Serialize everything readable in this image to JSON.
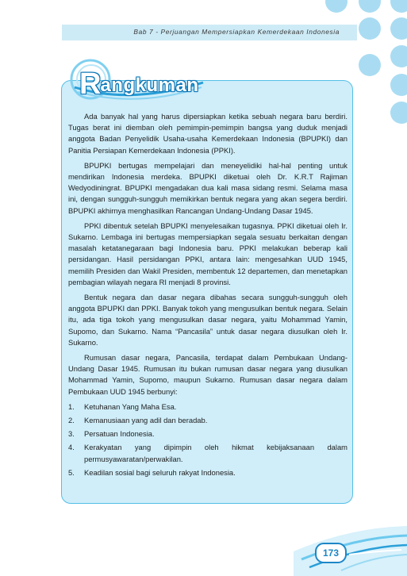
{
  "header": {
    "chapter_title": "Bab 7 - Perjuangan Mempersiapkan Kemerdekaan Indonesia"
  },
  "section": {
    "title_first": "R",
    "title_rest": "angkuman"
  },
  "paragraphs": [
    "Ada banyak hal yang harus dipersiapkan ketika sebuah negara baru berdiri. Tugas berat ini diemban oleh pemimpin-pemimpin bangsa yang duduk menjadi anggota Badan Penyelidik Usaha-usaha Kemerdekaan Indonesia (BPUPKI) dan Panitia Persiapan Kemerdekaan Indonesia (PPKI).",
    "BPUPKI bertugas mempelajari dan meneyelidiki hal-hal penting untuk mendirikan Indonesia merdeka. BPUPKI diketuai oleh Dr. K.R.T Rajiman Wedyodiningrat. BPUPKI mengadakan dua kali masa sidang resmi. Selama masa ini, dengan sungguh-sungguh memikirkan bentuk negara yang akan segera berdiri. BPUPKI akhirnya menghasilkan Rancangan Undang-Undang Dasar 1945.",
    "PPKI dibentuk setelah BPUPKI menyelesaikan tugasnya. PPKI diketuai oleh Ir. Sukarno. Lembaga ini bertugas mempersiapkan segala sesuatu berkaitan dengan masalah ketatanegaraan bagi Indonesia baru. PPKI melakukan beberap kali persidangan. Hasil persidangan PPKI, antara lain: mengesahkan UUD 1945, memilih Presiden dan Wakil Presiden, membentuk 12 departemen, dan menetapkan pembagian wilayah negara RI menjadi 8 provinsi.",
    "Bentuk negara dan dasar negara dibahas secara sungguh-sungguh oleh anggota BPUPKI dan PPKI. Banyak tokoh yang mengusulkan bentuk negara. Selain itu, ada tiga tokoh yang mengusulkan dasar negara, yaitu Mohammad Yamin, Supomo, dan Sukarno. Nama “Pancasila” untuk dasar negara diusulkan oleh Ir. Sukarno.",
    "Rumusan dasar negara, Pancasila, terdapat dalam Pembukaan Undang-Undang Dasar 1945. Rumusan itu bukan rumusan dasar negara yang diusulkan Mohammad Yamin, Supomo, maupun Sukarno. Rumusan dasar negara dalam Pembukaan UUD 1945 berbunyi:"
  ],
  "pancasila": [
    {
      "num": "1.",
      "text": "Ketuhanan Yang Maha Esa."
    },
    {
      "num": "2.",
      "text": "Kemanusiaan yang adil dan beradab."
    },
    {
      "num": "3.",
      "text": "Persatuan Indonesia."
    },
    {
      "num": "4.",
      "text": "Kerakyatan yang dipimpin oleh hikmat kebijaksanaan dalam permusyawaratan/perwakilan."
    },
    {
      "num": "5.",
      "text": "Keadilan sosial bagi seluruh rakyat Indonesia."
    }
  ],
  "footer": {
    "page_number": "173"
  }
}
